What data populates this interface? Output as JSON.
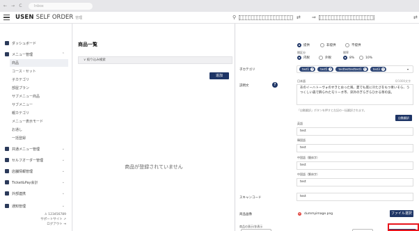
{
  "browser": {
    "back": "←",
    "forward": "→",
    "reload": "C",
    "address": "Inbox"
  },
  "header": {
    "brand_bold": "USEN",
    "brand_light": "SELF ORDER",
    "brand_sub": "管理"
  },
  "sidebar": {
    "items": [
      {
        "label": "ダッシュボード"
      },
      {
        "label": "メニュー管理"
      },
      {
        "label": "共通メニュー管理"
      },
      {
        "label": "セルフオーダー管理"
      },
      {
        "label": "店舗情報管理"
      },
      {
        "label": "Ticket&Pay会計"
      },
      {
        "label": "外部連携"
      },
      {
        "label": "通知管理"
      }
    ],
    "sub_items": [
      "商品",
      "コース・セット",
      "子カテゴリ",
      "部屋プラン",
      "サブメニュー商品",
      "サブメニュー",
      "親カテゴリ",
      "メニュー表示モード",
      "お通し",
      "一括登録"
    ],
    "footer": {
      "user_id": "123456789",
      "support": "サポートサイト",
      "logout": "ログアウト"
    }
  },
  "list_panel": {
    "title": "商品一覧",
    "filter": "絞り込み検索",
    "add_button": "追加",
    "empty_message": "商品が登録されていません"
  },
  "edit_panel": {
    "sale_status": {
      "options": [
        "提供",
        "非提供",
        "不提供"
      ],
      "selected": 0
    },
    "tax_type": {
      "label": "税区分",
      "options": [
        "内税",
        "外税"
      ],
      "selected": 0
    },
    "tax_rate": {
      "label": "税率",
      "options": [
        "8%",
        "10%"
      ],
      "selected": 0
    },
    "child_category": {
      "label": "子カテゴリ",
      "tags": [
        "test1",
        "test5",
        "testtesttesttest1",
        "test3"
      ]
    },
    "description": {
      "label": "説明文",
      "lang_ja": "日本語",
      "counter": "0/1000文字",
      "text": "あのイーハトーヴォのすきとおった風、夏でも底に冷たさをもつ青いそら、うつくしい森で飾られたモリーオ市、郊外のぎらぎらひかる草の波。",
      "hint": "「自動翻訳」ボタンを押すと左記の一括翻訳されます。",
      "auto_translate": "自動翻訳",
      "translations": [
        {
          "lang": "英語",
          "value": "test"
        },
        {
          "lang": "韓国語",
          "value": "test"
        },
        {
          "lang": "中国語（簡体字）",
          "value": "test"
        },
        {
          "lang": "中国語（繁体字）",
          "value": "test"
        }
      ]
    },
    "scan_code": {
      "label": "スキャンコード",
      "value": "test"
    },
    "product_image": {
      "label": "商品画像",
      "filename": "dummyimage.png",
      "button": "ファイル選択"
    },
    "footer_label": "商品の表示/非表示"
  }
}
